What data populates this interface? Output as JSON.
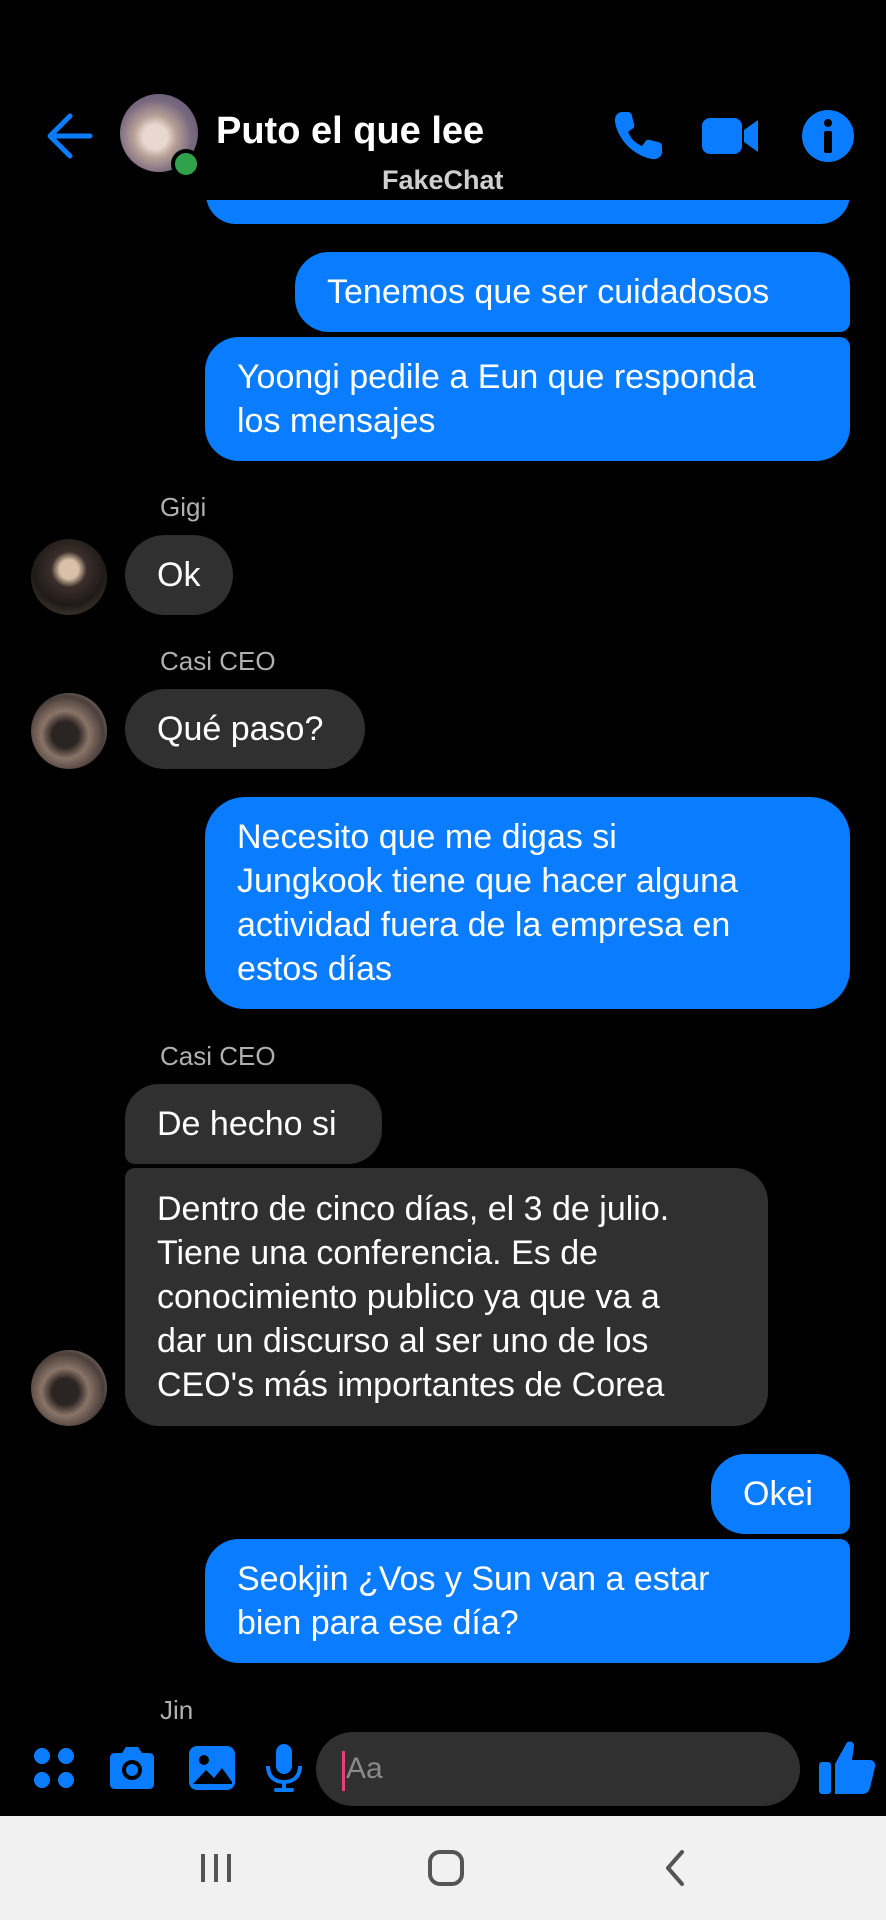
{
  "header": {
    "title": "Puto el que lee",
    "subtitle": "FakeChat",
    "accent": "#0a7cff"
  },
  "messages": [
    {
      "kind": "out",
      "text": "Tenemos que ser cuidadosos"
    },
    {
      "kind": "out",
      "text": "Yoongi pedile a Eun que responda\nlos mensajes"
    },
    {
      "kind": "sender",
      "text": "Gigi"
    },
    {
      "kind": "in",
      "text": "Ok"
    },
    {
      "kind": "sender",
      "text": "Casi CEO"
    },
    {
      "kind": "in",
      "text": "Qué paso?"
    },
    {
      "kind": "out",
      "text": "Necesito que me digas si\nJungkook tiene que hacer alguna\nactividad fuera de la empresa en\nestos días"
    },
    {
      "kind": "sender",
      "text": "Casi CEO"
    },
    {
      "kind": "in",
      "text": "De hecho si"
    },
    {
      "kind": "in",
      "text": "Dentro de cinco días, el 3 de julio.\nTiene una conferencia. Es de\nconocimiento publico ya que va a\ndar un discurso al ser uno de los\nCEO's más importantes de Corea"
    },
    {
      "kind": "out",
      "text": "Okei"
    },
    {
      "kind": "out",
      "text": "Seokjin ¿Vos y Sun van a estar\nbien para ese día?"
    },
    {
      "kind": "sender",
      "text": "Jin"
    }
  ],
  "composer": {
    "placeholder": "Aa",
    "icons": [
      "menu-icon",
      "camera-icon",
      "image-icon",
      "microphone-icon",
      "emoji-icon",
      "like-icon"
    ]
  },
  "navbar": {
    "icons": [
      "recent-apps-icon",
      "home-icon",
      "back-icon"
    ]
  }
}
